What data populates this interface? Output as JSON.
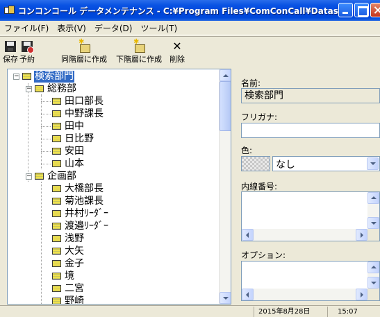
{
  "window": {
    "title": "コンコンコール データメンテナンス - C:¥Program Files¥ComConCall¥Datas¥dbCCC.m..."
  },
  "menu": [
    "ファイル(F)",
    "表示(V)",
    "データ(D)",
    "ツール(T)"
  ],
  "toolbar": {
    "save": "保存",
    "plan": "予約",
    "new_sibling": "同階層に作成",
    "new_child": "下階層に作成",
    "delete": "削除"
  },
  "tree": {
    "root": "検索部門",
    "groups": [
      {
        "name": "総務部",
        "members": [
          "田口部長",
          "中野課長",
          "田中",
          "日比野",
          "安田",
          "山本"
        ]
      },
      {
        "name": "企画部",
        "members": [
          "大橋部長",
          "菊池課長",
          "井村ﾘｰﾀﾞｰ",
          "渡邉ﾘｰﾀﾞｰ",
          "浅野",
          "大矢",
          "金子",
          "境",
          "二宮",
          "野崎"
        ]
      }
    ]
  },
  "details": {
    "name_label": "名前:",
    "name_value": "検索部門",
    "furigana_label": "フリガナ:",
    "furigana_value": "",
    "color_label": "色:",
    "color_value": "なし",
    "extension_label": "内線番号:",
    "option_label": "オプション:"
  },
  "status": {
    "date": "2015年8月28日",
    "time": "15:07"
  }
}
